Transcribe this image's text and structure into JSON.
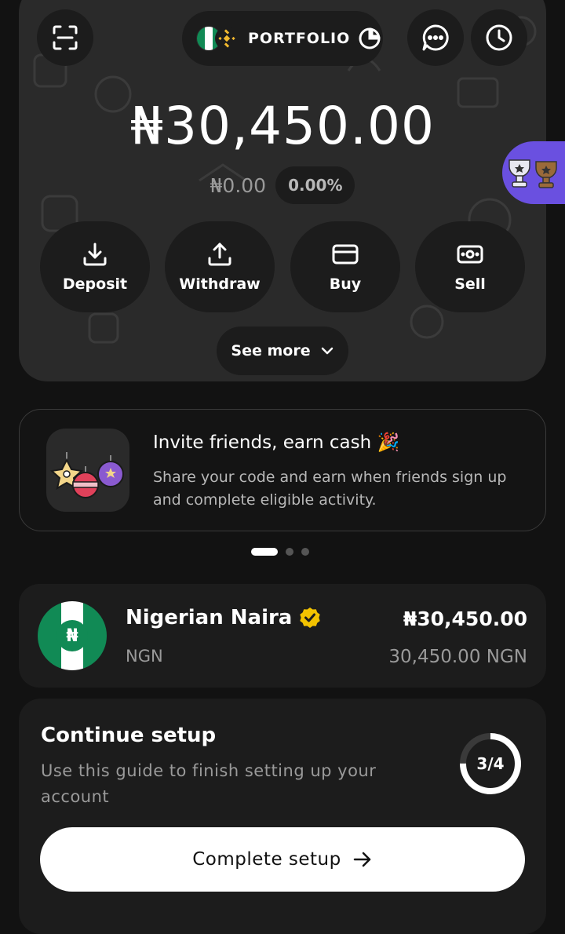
{
  "colors": {
    "background": "#121212",
    "card": "#1c1c1c",
    "hero": "#2a2a2a",
    "accent_purple": "#6a50e0",
    "nigeria_green": "#118a55",
    "verified_yellow": "#f2c200",
    "text_muted": "#9a9a9a"
  },
  "header": {
    "scan_icon": "scan-icon",
    "portfolio_label": "PORTFOLIO",
    "portfolio_icons": [
      "nigeria-flag-icon",
      "bnb-icon",
      "pie-chart-icon"
    ],
    "chat_icon": "chat-bubble-icon",
    "history_icon": "clock-icon"
  },
  "balance": {
    "total": "₦30,450.00",
    "change_amount": "₦0.00",
    "change_percent": "0.00%"
  },
  "actions": [
    {
      "label": "Deposit",
      "icon": "download-icon"
    },
    {
      "label": "Withdraw",
      "icon": "upload-icon"
    },
    {
      "label": "Buy",
      "icon": "card-icon"
    },
    {
      "label": "Sell",
      "icon": "cash-icon"
    }
  ],
  "see_more": {
    "label": "See more",
    "icon": "chevron-down-icon"
  },
  "rewards_tab": {
    "icon": "trophy-icon"
  },
  "promo": {
    "title": "Invite friends, earn cash 🎉",
    "text": "Share your code and earn when friends sign up and complete eligible activity.",
    "image": "ornaments-illustration",
    "carousel_index": 1,
    "carousel_total": 3
  },
  "asset": {
    "name": "Nigerian Naira",
    "code": "NGN",
    "fiat_value": "₦30,450.00",
    "native_value": "30,450.00 NGN",
    "verified": true,
    "symbol": "₦"
  },
  "setup": {
    "title": "Continue setup",
    "text": "Use this guide to finish setting up your account",
    "progress_label": "3/4",
    "progress_fraction": 0.75,
    "button_label": "Complete setup",
    "button_icon": "arrow-right-icon"
  }
}
